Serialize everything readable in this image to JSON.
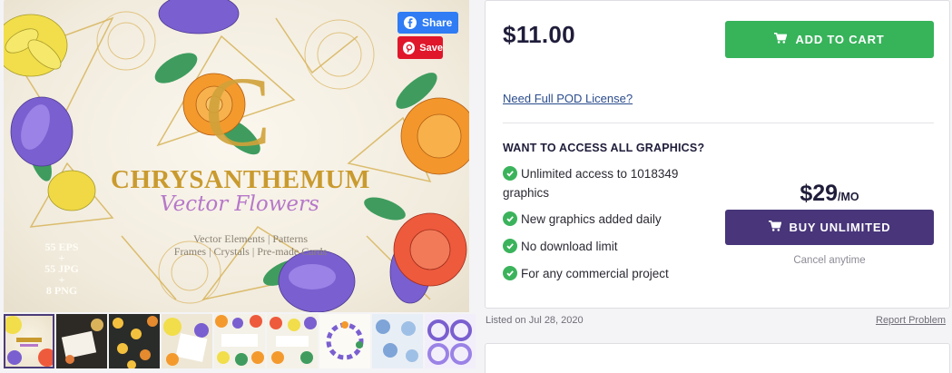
{
  "hero": {
    "title": "CHRYSANTHEMUM",
    "subtitle": "Vector Flowers",
    "features_line1": "Vector Elements | Patterns",
    "features_line2": "Frames | Crystals | Pre-made Cards",
    "counts_line1": "55 EPS",
    "counts_line2": "+",
    "counts_line3": "55 JPG",
    "counts_line4": "+",
    "counts_line5": "8 PNG",
    "monogram": "C"
  },
  "social": {
    "share_label": "Share",
    "save_label": "Save"
  },
  "thumbnails": [
    "thumb-1",
    "thumb-2",
    "thumb-3",
    "thumb-4",
    "thumb-5",
    "thumb-6",
    "thumb-7",
    "thumb-8",
    "thumb-9"
  ],
  "purchase": {
    "price": "$11.00",
    "add_to_cart_label": "ADD TO CART",
    "pod_link": "Need Full POD License?",
    "access_title": "WANT TO ACCESS ALL GRAPHICS?",
    "features": [
      {
        "line1": "Unlimited access to 1018349",
        "line2": "graphics"
      },
      {
        "line1": "New graphics added daily",
        "line2": ""
      },
      {
        "line1": "No download limit",
        "line2": ""
      },
      {
        "line1": "For any commercial project",
        "line2": ""
      }
    ],
    "unlimited_price": "$29",
    "unlimited_period": "/MO",
    "buy_unlimited_label": "BUY UNLIMITED",
    "cancel_text": "Cancel anytime"
  },
  "meta": {
    "listed_on": "Listed on Jul 28, 2020",
    "report_label": "Report Problem"
  },
  "colors": {
    "cart_green": "#37b35a",
    "unlimited_purple": "#48357a",
    "check_green": "#3bb35c",
    "share_blue": "#2f7cf4",
    "save_red": "#e0162b"
  }
}
